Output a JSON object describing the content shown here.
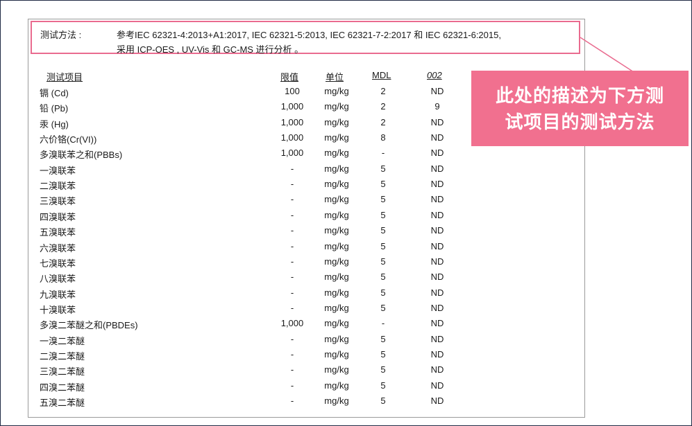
{
  "method": {
    "label": "测试方法 :",
    "line1": "参考IEC 62321-4:2013+A1:2017, IEC 62321-5:2013,  IEC 62321-7-2:2017 和  IEC 62321-6:2015,",
    "line2": "采用 ICP-OES , UV-Vis  和 GC-MS 进行分析 。"
  },
  "table": {
    "headers": {
      "name": "测试项目",
      "limit": "限值",
      "unit": "单位",
      "mdl": "MDL",
      "result": "002"
    },
    "rows": [
      {
        "name": "镉 (Cd)",
        "limit": "100",
        "unit": "mg/kg",
        "mdl": "2",
        "result": "ND"
      },
      {
        "name": "铅 (Pb)",
        "limit": "1,000",
        "unit": "mg/kg",
        "mdl": "2",
        "result": "9"
      },
      {
        "name": "汞 (Hg)",
        "limit": "1,000",
        "unit": "mg/kg",
        "mdl": "2",
        "result": "ND"
      },
      {
        "name": "六价铬(Cr(VI))",
        "limit": "1,000",
        "unit": "mg/kg",
        "mdl": "8",
        "result": "ND"
      },
      {
        "name": "多溴联苯之和(PBBs)",
        "limit": "1,000",
        "unit": "mg/kg",
        "mdl": "-",
        "result": "ND"
      },
      {
        "name": "一溴联苯",
        "limit": "-",
        "unit": "mg/kg",
        "mdl": "5",
        "result": "ND"
      },
      {
        "name": "二溴联苯",
        "limit": "-",
        "unit": "mg/kg",
        "mdl": "5",
        "result": "ND"
      },
      {
        "name": "三溴联苯",
        "limit": "-",
        "unit": "mg/kg",
        "mdl": "5",
        "result": "ND"
      },
      {
        "name": "四溴联苯",
        "limit": "-",
        "unit": "mg/kg",
        "mdl": "5",
        "result": "ND"
      },
      {
        "name": "五溴联苯",
        "limit": "-",
        "unit": "mg/kg",
        "mdl": "5",
        "result": "ND"
      },
      {
        "name": "六溴联苯",
        "limit": "-",
        "unit": "mg/kg",
        "mdl": "5",
        "result": "ND"
      },
      {
        "name": "七溴联苯",
        "limit": "-",
        "unit": "mg/kg",
        "mdl": "5",
        "result": "ND"
      },
      {
        "name": "八溴联苯",
        "limit": "-",
        "unit": "mg/kg",
        "mdl": "5",
        "result": "ND"
      },
      {
        "name": "九溴联苯",
        "limit": "-",
        "unit": "mg/kg",
        "mdl": "5",
        "result": "ND"
      },
      {
        "name": "十溴联苯",
        "limit": "-",
        "unit": "mg/kg",
        "mdl": "5",
        "result": "ND"
      },
      {
        "name": "多溴二苯醚之和(PBDEs)",
        "limit": "1,000",
        "unit": "mg/kg",
        "mdl": "-",
        "result": "ND"
      },
      {
        "name": "一溴二苯醚",
        "limit": "-",
        "unit": "mg/kg",
        "mdl": "5",
        "result": "ND"
      },
      {
        "name": "二溴二苯醚",
        "limit": "-",
        "unit": "mg/kg",
        "mdl": "5",
        "result": "ND"
      },
      {
        "name": "三溴二苯醚",
        "limit": "-",
        "unit": "mg/kg",
        "mdl": "5",
        "result": "ND"
      },
      {
        "name": "四溴二苯醚",
        "limit": "-",
        "unit": "mg/kg",
        "mdl": "5",
        "result": "ND"
      },
      {
        "name": "五溴二苯醚",
        "limit": "-",
        "unit": "mg/kg",
        "mdl": "5",
        "result": "ND"
      }
    ]
  },
  "callout": {
    "line1": "此处的描述为下方测",
    "line2": "试项目的测试方法"
  },
  "colors": {
    "highlight": "#e96b8f",
    "callout_bg": "#f1708f"
  }
}
